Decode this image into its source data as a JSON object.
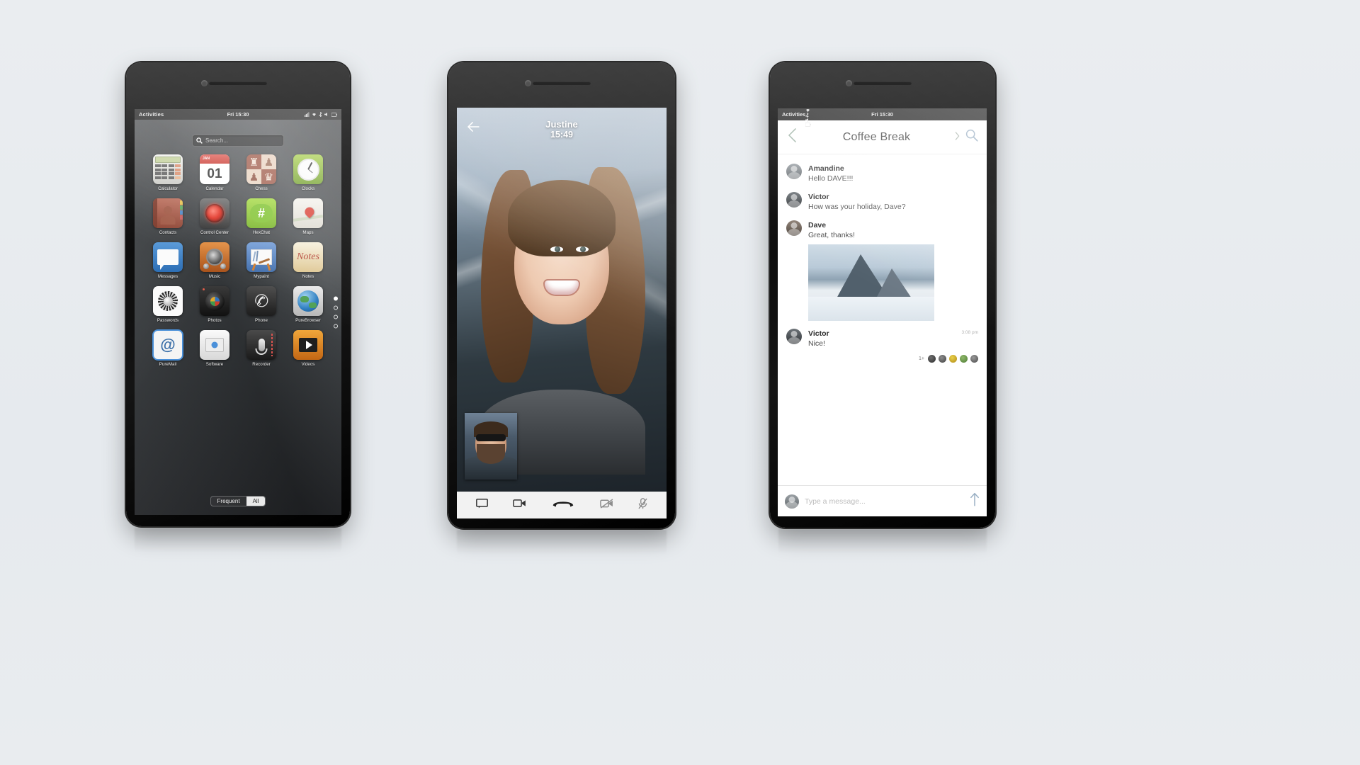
{
  "meta": {
    "bg_color": "#e8ecef"
  },
  "phone1": {
    "name": "app-grid-phone",
    "shell": {
      "activities": "Activities",
      "clock": "Fri 15:30",
      "tray_icons": [
        "signal-icon",
        "wifi-icon",
        "bluetooth-icon",
        "volume-icon",
        "battery-icon"
      ]
    },
    "search": {
      "placeholder": "Search...",
      "icon": "search-icon"
    },
    "apps": [
      {
        "label": "Calculator",
        "icon": "calculator-icon"
      },
      {
        "label": "Calendar",
        "icon": "calendar-icon",
        "month": "JAN",
        "day": "01"
      },
      {
        "label": "Chess",
        "icon": "chess-icon"
      },
      {
        "label": "Clocks",
        "icon": "clock-icon"
      },
      {
        "label": "Contacts",
        "icon": "contacts-icon"
      },
      {
        "label": "Control Center",
        "icon": "control-center-icon"
      },
      {
        "label": "HexChat",
        "icon": "hexchat-icon",
        "glyph": "#"
      },
      {
        "label": "Maps",
        "icon": "maps-icon"
      },
      {
        "label": "Messages",
        "icon": "messages-icon"
      },
      {
        "label": "Music",
        "icon": "music-icon"
      },
      {
        "label": "Mypaint",
        "icon": "mypaint-icon"
      },
      {
        "label": "Notes",
        "icon": "notes-icon",
        "glyph": "Notes"
      },
      {
        "label": "Passwords",
        "icon": "passwords-icon"
      },
      {
        "label": "Photos",
        "icon": "photos-icon"
      },
      {
        "label": "Phone",
        "icon": "phone-icon"
      },
      {
        "label": "PureBrowser",
        "icon": "globe-icon"
      },
      {
        "label": "PureMail",
        "icon": "mail-icon",
        "glyph": "@"
      },
      {
        "label": "Software",
        "icon": "software-icon"
      },
      {
        "label": "Recorder",
        "icon": "microphone-icon"
      },
      {
        "label": "Videos",
        "icon": "videos-icon"
      }
    ],
    "pager": {
      "total": 4,
      "active": 0
    },
    "tabs": [
      {
        "label": "Frequent",
        "active": false
      },
      {
        "label": "All",
        "active": true
      }
    ]
  },
  "phone2": {
    "name": "video-call-phone",
    "caller": "Justine",
    "duration": "15:49",
    "back_icon": "back-arrow-icon",
    "self_view": "self-video-thumbnail",
    "controls": [
      {
        "name": "chat-button",
        "icon": "chat-bubble-icon"
      },
      {
        "name": "switch-camera-button",
        "icon": "camera-switch-icon"
      },
      {
        "name": "hangup-button",
        "icon": "hangup-phone-icon"
      },
      {
        "name": "video-off-button",
        "icon": "video-off-icon"
      },
      {
        "name": "mute-button",
        "icon": "mic-off-icon"
      }
    ]
  },
  "phone3": {
    "name": "chat-phone",
    "shell": {
      "activities": "Activities",
      "clock": "Fri 15:30"
    },
    "header": {
      "back_icon": "chevron-left-icon",
      "title": "Coffee Break",
      "forward_icon": "chevron-right-icon",
      "search_icon": "search-icon"
    },
    "messages": [
      {
        "author": "Amandine",
        "text": "Hello DAVE!!!",
        "avatar": "avatar-amandine"
      },
      {
        "author": "Victor",
        "text": "How was your holiday, Dave?",
        "avatar": "avatar-victor"
      },
      {
        "author": "Dave",
        "text": "Great, thanks!",
        "avatar": "avatar-dave",
        "attachment": "mountain-photo"
      },
      {
        "author": "Victor",
        "text": "Nice!",
        "avatar": "avatar-victor",
        "timestamp": "3:08 pm"
      }
    ],
    "reactions": {
      "more": "1+",
      "emoji": [
        "😀",
        "😎",
        "😁",
        "😍",
        "🙌"
      ]
    },
    "composer": {
      "placeholder": "Type a message...",
      "send_icon": "send-arrow-icon",
      "avatar": "avatar-me"
    }
  }
}
